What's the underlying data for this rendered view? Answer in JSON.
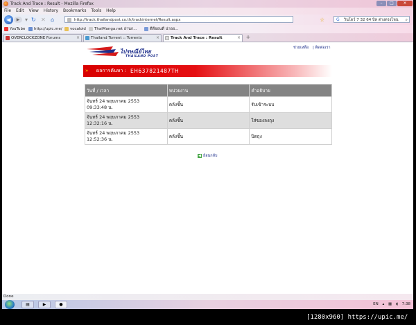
{
  "browser": {
    "title": "Track And Trace : Result - Mozilla Firefox",
    "menu": [
      "File",
      "Edit",
      "View",
      "History",
      "Bookmarks",
      "Tools",
      "Help"
    ],
    "url": "http://track.thailandpost.co.th/trackinternet/Result.aspx",
    "search_value": "วินโดว์ 7 32 64 บิท ต่างตรงไหน",
    "bookmarks": [
      "YouTube",
      "http://upic.me/",
      "vocaloid",
      "ThaiManga.net อ่านก...",
      "ดีดีออนดี น่าอย..."
    ],
    "tabs": [
      {
        "label": "OVERCLOCKZONE Forums",
        "active": false
      },
      {
        "label": "Thailand Torrent :: Torrents",
        "active": false
      },
      {
        "label": "Track And Trace : Result",
        "active": true
      }
    ],
    "status": "Done"
  },
  "page": {
    "logo_text": "ไปรษณีย์ไทย",
    "logo_sub": "THAILAND POST",
    "links": [
      "ช่วยเหลือ",
      "| ติดต่อเรา"
    ],
    "search_label": "ผลการค้นหา :",
    "tracking_number": "EH637821487TH",
    "table": {
      "headers": [
        "วันที่ / เวลา",
        "หน่วยงาน",
        "คำอธิบาย"
      ],
      "rows": [
        {
          "date": "จันทร์ 24 พฤษภาคม 2553",
          "time": "09:33:48 น.",
          "office": "คลังชิ้น",
          "desc": "รับเข้าระบบ"
        },
        {
          "date": "จันทร์ 24 พฤษภาคม 2553",
          "time": "12:32:16 น.",
          "office": "คลังชิ้น",
          "desc": "ใส่ของลงถุง"
        },
        {
          "date": "จันทร์ 24 พฤษภาคม 2553",
          "time": "12:52:36 น.",
          "office": "คลังชิ้น",
          "desc": "ปิดถุง"
        }
      ]
    },
    "back_label": "ย้อนกลับ"
  },
  "taskbar": {
    "lang": "EN",
    "clock": "7:38"
  },
  "watermark": "[1280x960] https://upic.me/"
}
